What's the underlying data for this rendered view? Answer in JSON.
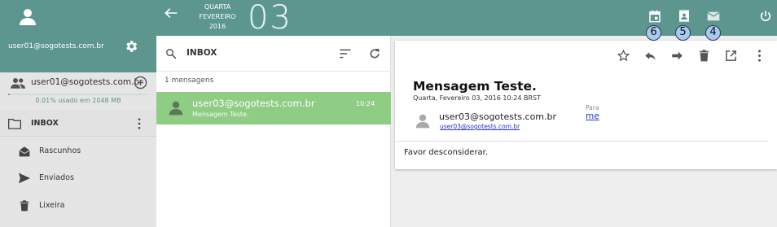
{
  "sidebar": {
    "user_email": "user01@sogotests.com.br",
    "account_label": "user01@sogotests.com.br",
    "quota_text": "0.01% usado em 2048 MB",
    "quota_fraction": 0.0001,
    "folders": [
      {
        "label": "INBOX",
        "icon": "folder-icon"
      },
      {
        "label": "Rascunhos",
        "icon": "drafts-icon"
      },
      {
        "label": "Enviados",
        "icon": "send-icon"
      },
      {
        "label": "Lixeira",
        "icon": "trash-icon"
      }
    ]
  },
  "topbar": {
    "weekday": "QUARTA",
    "month": "FEVEREIRO",
    "year": "2016",
    "day": "03",
    "badges": [
      "6",
      "5",
      "4"
    ]
  },
  "list": {
    "search_text": "INBOX",
    "count_text": "1 mensagens",
    "messages": [
      {
        "from": "user03@sogotests.com.br",
        "subject": "Mensagem Teste.",
        "time": "10:24"
      }
    ]
  },
  "message": {
    "title": "Mensagem Teste.",
    "date": "Quarta, Fevereiro 03, 2016 10:24 BRST",
    "sender_name": "user03@sogotests.com.br",
    "sender_email": "user03@sogotests.com.br",
    "to_label": "Para",
    "to_value": "me",
    "body": "Favor desconsiderar."
  },
  "colors": {
    "accent": "#5c968f",
    "selected_row": "#8fcc84",
    "badge": "#a9c9ee",
    "link": "#2234c8"
  }
}
